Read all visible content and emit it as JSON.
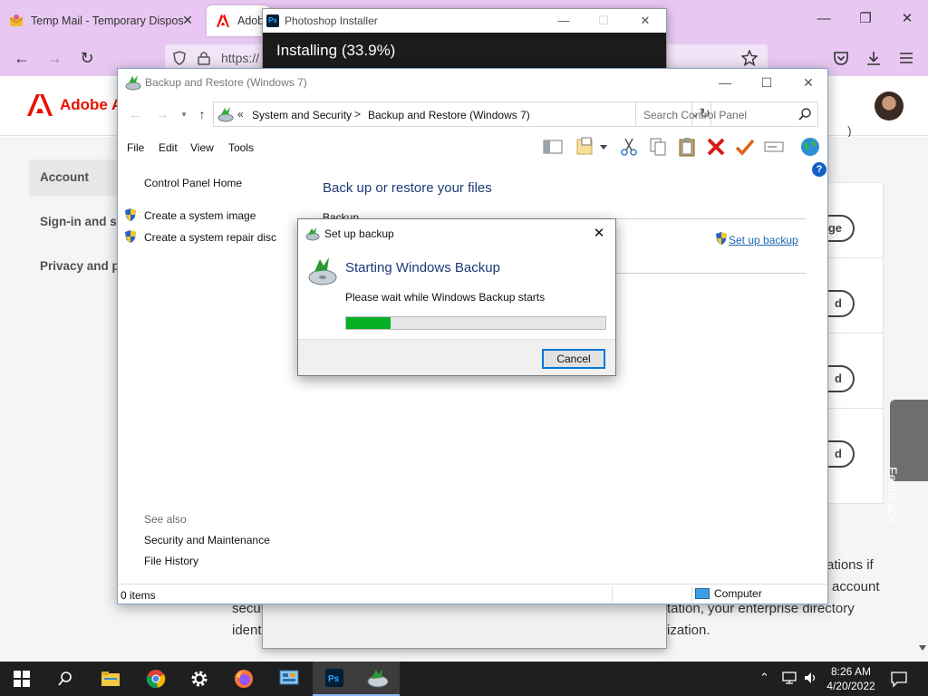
{
  "browser": {
    "tabs": [
      {
        "title": "Temp Mail - Temporary Dispos"
      },
      {
        "title": "Adobe"
      }
    ],
    "url": "https://",
    "window_controls": {
      "minimize": "—",
      "restore": "❐",
      "close": "✕"
    }
  },
  "adobe": {
    "brand": "Adobe A",
    "sidebar": [
      {
        "label": "Account",
        "active": true
      },
      {
        "label": "Sign-in and se",
        "active": false
      },
      {
        "label": "Privacy and pe",
        "active": false
      }
    ],
    "card_buttons": [
      "ge",
      "d",
      "d",
      "d"
    ],
    "header_tail": ")",
    "feedback": "Feedback",
    "paragraph": {
      "line1": "ations if",
      "line2": "account",
      "line3_left": "secu",
      "line3_right": "tation, your enterprise directory",
      "line4_left": "ident",
      "line4_right": "ization."
    }
  },
  "photoshop_installer": {
    "title": "Photoshop Installer",
    "icon_label": "Ps",
    "status": "Installing (33.9%)"
  },
  "backup_window": {
    "title": "Backup and Restore (Windows 7)",
    "breadcrumb": {
      "prefix": "«",
      "part1": "System and Security",
      "separator": ">",
      "part2": "Backup and Restore (Windows 7)"
    },
    "search_placeholder": "Search Control Panel",
    "menu": [
      "File",
      "Edit",
      "View",
      "Tools"
    ],
    "left_links": {
      "home": "Control Panel Home",
      "system_image": "Create a system image",
      "repair_disc": "Create a system repair disc",
      "see_also": "See also",
      "security": "Security and Maintenance",
      "file_history": "File History"
    },
    "main": {
      "heading": "Back up or restore your files",
      "section_label": "Backup",
      "setup_link": "Set up backup"
    },
    "help": "?",
    "status": {
      "items": "0 items",
      "location": "Computer"
    }
  },
  "setup_dialog": {
    "title": "Set up backup",
    "heading": "Starting Windows Backup",
    "message": "Please wait while Windows Backup starts",
    "progress": 0.17,
    "cancel_label": "Cancel",
    "progress_color": "#06b025"
  },
  "taskbar": {
    "apps": [
      "windows-start",
      "search",
      "file-explorer",
      "chrome",
      "settings",
      "firefox",
      "control-panel",
      "photoshop",
      "backup-restore"
    ],
    "time": "8:26 AM",
    "date": "4/20/2022"
  },
  "colors": {
    "firefox_chrome": "#e8c8f2",
    "adobe_red": "#eb1000",
    "link_blue": "#1b65b5",
    "heading_blue": "#1b3b78"
  }
}
